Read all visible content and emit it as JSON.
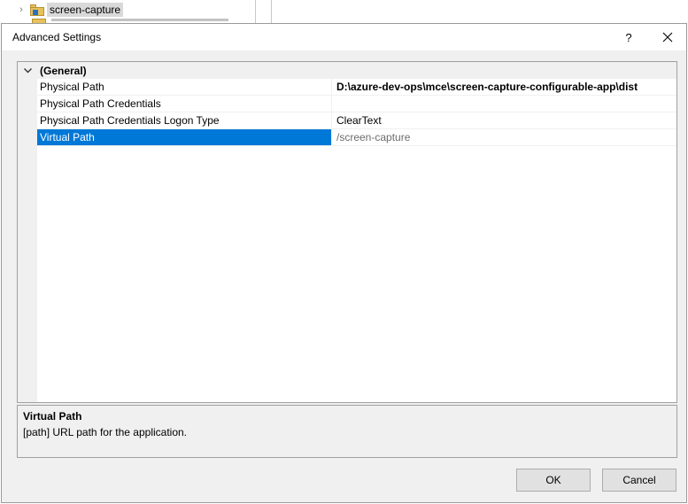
{
  "background": {
    "tree_item_label": "screen-capture"
  },
  "dialog": {
    "title": "Advanced Settings",
    "help_label": "?",
    "colors": {
      "selection": "#0078d7",
      "category_bg": "#f0f0f0",
      "dim_value": "#6d6d6d"
    }
  },
  "grid": {
    "category": "(General)",
    "rows": [
      {
        "name": "Physical Path",
        "value": "D:\\azure-dev-ops\\mce\\screen-capture-configurable-app\\dist"
      },
      {
        "name": "Physical Path Credentials",
        "value": ""
      },
      {
        "name": "Physical Path Credentials Logon Type",
        "value": "ClearText"
      },
      {
        "name": "Virtual Path",
        "value": "/screen-capture"
      }
    ]
  },
  "description": {
    "title": "Virtual Path",
    "text": "[path] URL path for the application."
  },
  "buttons": {
    "ok": "OK",
    "cancel": "Cancel"
  }
}
